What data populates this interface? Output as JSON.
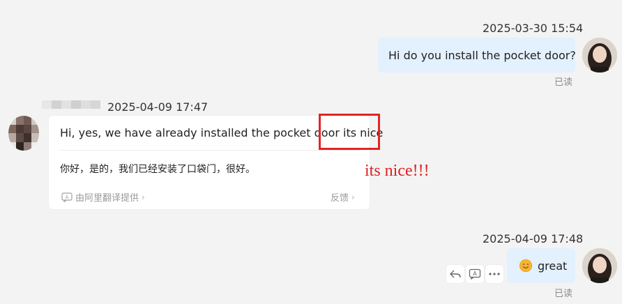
{
  "messages": {
    "outgoing_1": {
      "timestamp": "2025-03-30 15:54",
      "text": "Hi do you install the pocket door?",
      "status": "已读"
    },
    "incoming_1": {
      "timestamp": "2025-04-09 17:47",
      "original_text": "Hi, yes, we have already installed the pocket door its nice",
      "translation": "你好，是的，我们已经安装了口袋门，很好。",
      "provider_label": "由阿里翻译提供",
      "feedback_label": "反馈"
    },
    "outgoing_2": {
      "timestamp": "2025-04-09 17:48",
      "text": "great",
      "emoji_icon": "smiling-face-icon",
      "status": "已读"
    }
  },
  "annotation": {
    "text": "its nice!!!",
    "color": "#e02020"
  },
  "colors": {
    "background": "#f3f3f3",
    "outgoing_bubble": "#e3f0fd",
    "highlight": "#e22424"
  },
  "message_actions": [
    "reply-icon",
    "translate-icon",
    "more-icon"
  ]
}
